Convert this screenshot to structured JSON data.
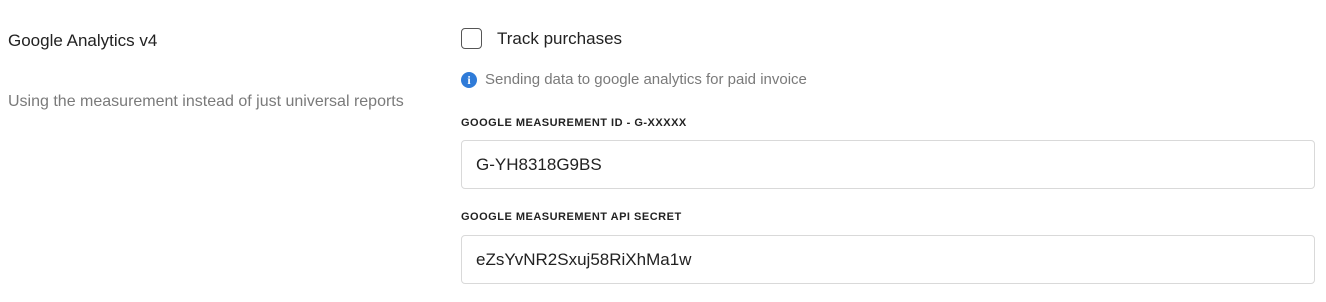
{
  "section": {
    "title": "Google Analytics v4",
    "description": "Using the measurement instead of just universal reports"
  },
  "track_purchases": {
    "label": "Track purchases",
    "checked": false
  },
  "hint": {
    "icon": "info-icon",
    "text": "Sending data to google analytics for paid invoice"
  },
  "fields": {
    "measurement_id": {
      "label": "GOOGLE MEASUREMENT ID - G-XXXXX",
      "value": "G-YH8318G9BS"
    },
    "api_secret": {
      "label": "GOOGLE MEASUREMENT API SECRET",
      "value": "eZsYvNR2Sxuj58RiXhMa1w"
    }
  },
  "colors": {
    "info_icon": "#2f7bd8",
    "muted_text": "#7a7a7a",
    "input_border": "#d9d9d9"
  }
}
